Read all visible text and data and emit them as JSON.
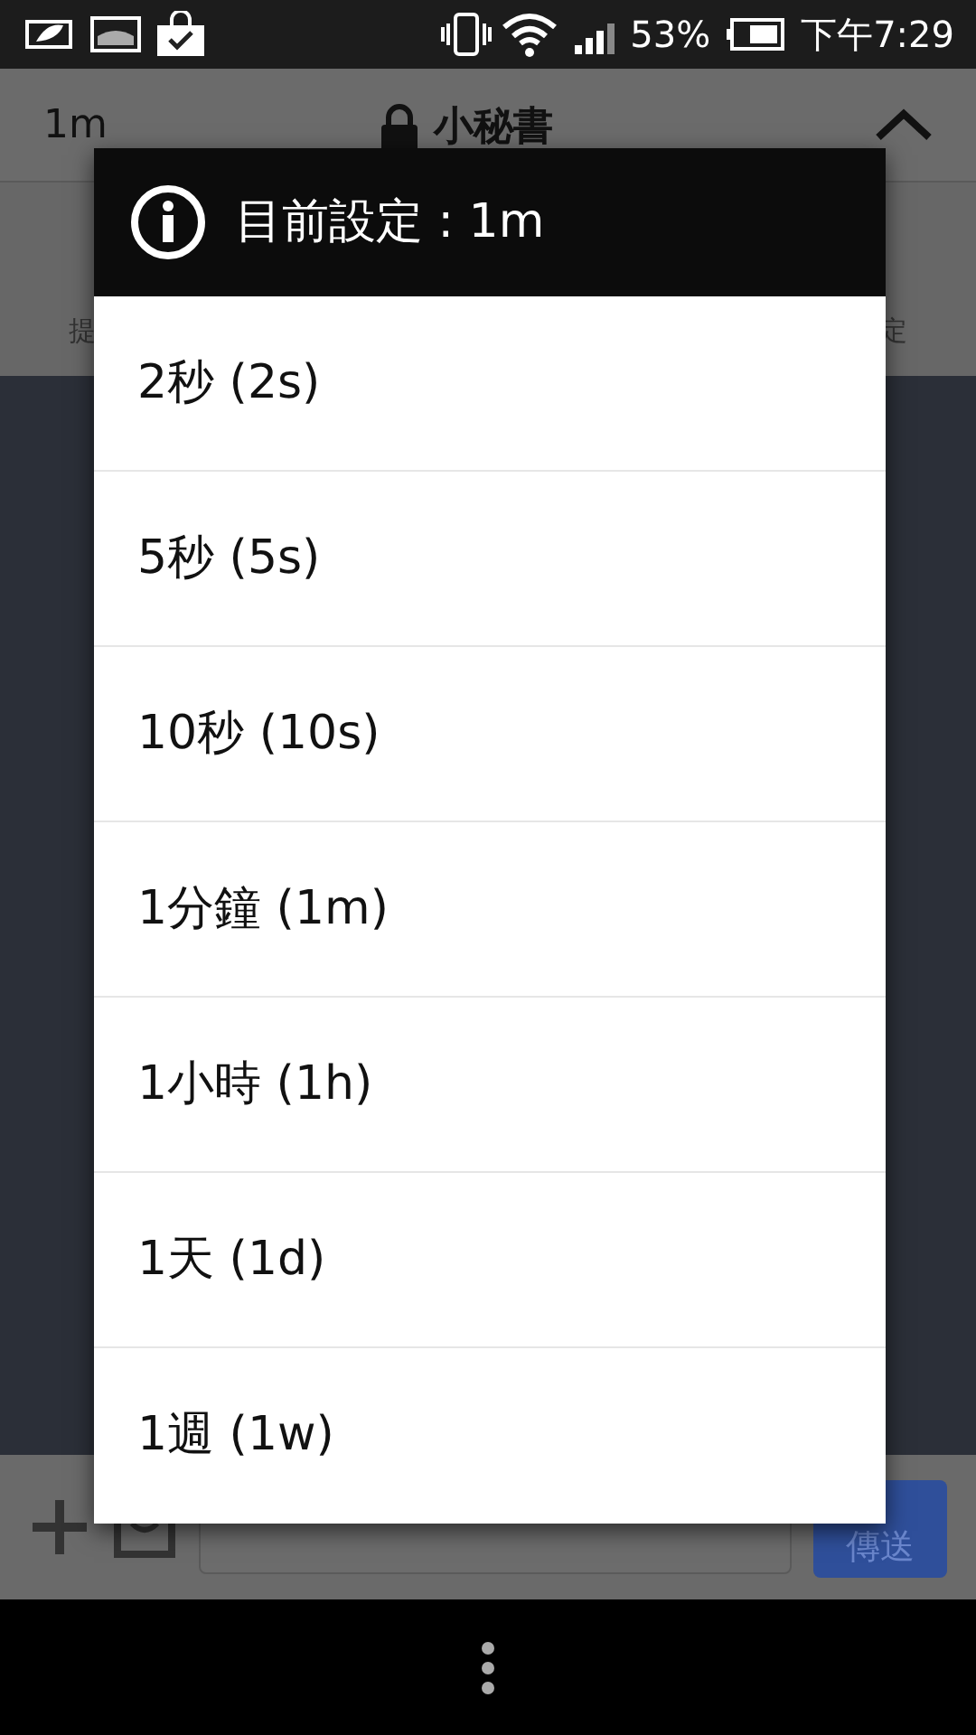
{
  "status_bar": {
    "battery_percent": "53%",
    "time": "下午7:29"
  },
  "header": {
    "interval": "1m",
    "title": "小秘書"
  },
  "toolbar": {
    "labels": [
      "提",
      "定"
    ]
  },
  "composer": {
    "send_button": "傳送"
  },
  "dialog": {
    "title": "目前設定 : 1m",
    "options": [
      {
        "label": "2秒 (2s)"
      },
      {
        "label": "5秒 (5s)"
      },
      {
        "label": "10秒 (10s)"
      },
      {
        "label": "1分鐘 (1m)"
      },
      {
        "label": "1小時 (1h)"
      },
      {
        "label": "1天 (1d)"
      },
      {
        "label": "1週 (1w)"
      }
    ]
  }
}
